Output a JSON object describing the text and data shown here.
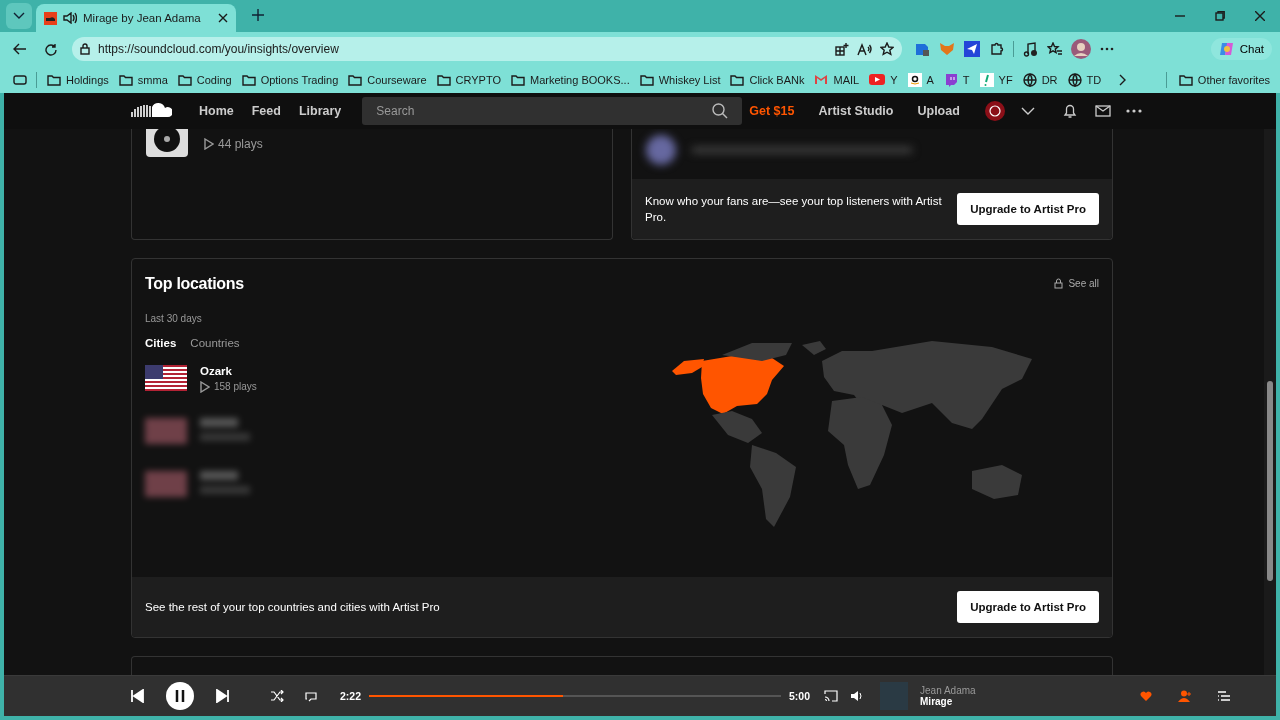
{
  "browser": {
    "tab_title": "Mirage by Jean Adama",
    "url": "https://soundcloud.com/you/insights/overview",
    "chat_label": "Chat",
    "bookmarks": [
      {
        "label": "Holdings",
        "kind": "folder"
      },
      {
        "label": "smma",
        "kind": "folder"
      },
      {
        "label": "Coding",
        "kind": "folder"
      },
      {
        "label": "Options Trading",
        "kind": "folder"
      },
      {
        "label": "Courseware",
        "kind": "folder"
      },
      {
        "label": "CRYPTO",
        "kind": "folder"
      },
      {
        "label": "Marketing BOOKS...",
        "kind": "folder"
      },
      {
        "label": "Whiskey List",
        "kind": "folder"
      },
      {
        "label": "Click BANk",
        "kind": "folder"
      },
      {
        "label": "MAIL",
        "kind": "mail"
      },
      {
        "label": "Y",
        "kind": "video"
      },
      {
        "label": "A",
        "kind": "store"
      },
      {
        "label": "T",
        "kind": "stream"
      },
      {
        "label": "YF",
        "kind": "finance"
      },
      {
        "label": "DR",
        "kind": "globe"
      },
      {
        "label": "TD",
        "kind": "globe"
      }
    ],
    "other_favorites": "Other favorites"
  },
  "nav": {
    "items": [
      "Home",
      "Feed",
      "Library"
    ],
    "search": {
      "placeholder": "Search"
    },
    "promo": "Get $15",
    "links": [
      "Artist Studio",
      "Upload"
    ]
  },
  "top_track": {
    "plays": "44 plays"
  },
  "listeners": {
    "message": "Know who your fans are—see your top listeners with Artist Pro.",
    "button": "Upgrade to Artist Pro"
  },
  "locations": {
    "title": "Top locations",
    "see_all": "See all",
    "period": "Last 30 days",
    "tabs": [
      {
        "label": "Cities",
        "selected": true
      },
      {
        "label": "Countries",
        "selected": false
      }
    ],
    "cities": [
      {
        "name": "Ozark",
        "plays": "158 plays",
        "blurred": false
      },
      {
        "blurred": true
      },
      {
        "blurred": true
      }
    ],
    "footer": "See the rest of your top countries and cities with Artist Pro",
    "button": "Upgrade to Artist Pro"
  },
  "player": {
    "elapsed": "2:22",
    "duration": "5:00",
    "level": 0.47,
    "artist": "Jean Adama",
    "track": "Mirage",
    "liked": true
  }
}
